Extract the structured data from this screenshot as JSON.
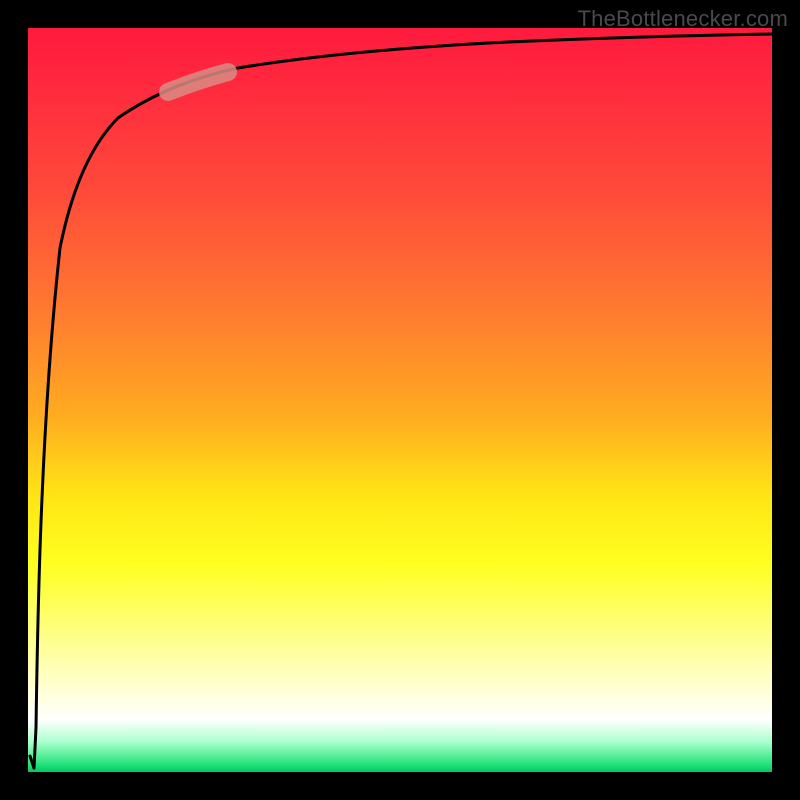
{
  "attribution": "TheBottlenecker.com",
  "chart_data": {
    "type": "line",
    "title": "",
    "xlabel": "",
    "ylabel": "",
    "xlim": [
      0,
      100
    ],
    "ylim": [
      0,
      100
    ],
    "series": [
      {
        "name": "curve",
        "x": [
          0.5,
          1,
          1.5,
          2,
          3,
          4,
          5,
          7,
          10,
          15,
          20,
          25,
          30,
          40,
          50,
          60,
          70,
          80,
          90,
          100
        ],
        "y": [
          2,
          20,
          45,
          60,
          74,
          80,
          84,
          88,
          91,
          93,
          94.5,
          95.5,
          96.2,
          97.0,
          97.6,
          98.0,
          98.3,
          98.6,
          98.8,
          99.0
        ]
      }
    ],
    "highlight_segment": {
      "x_start": 20,
      "x_end": 28,
      "note": "salmon pill marker on curve"
    },
    "background_gradient_stops": [
      {
        "pos": 0,
        "color": "#ff1a3e"
      },
      {
        "pos": 40,
        "color": "#ff8a2a"
      },
      {
        "pos": 70,
        "color": "#ffff20"
      },
      {
        "pos": 93,
        "color": "#ffffff"
      },
      {
        "pos": 100,
        "color": "#00c862"
      }
    ]
  }
}
